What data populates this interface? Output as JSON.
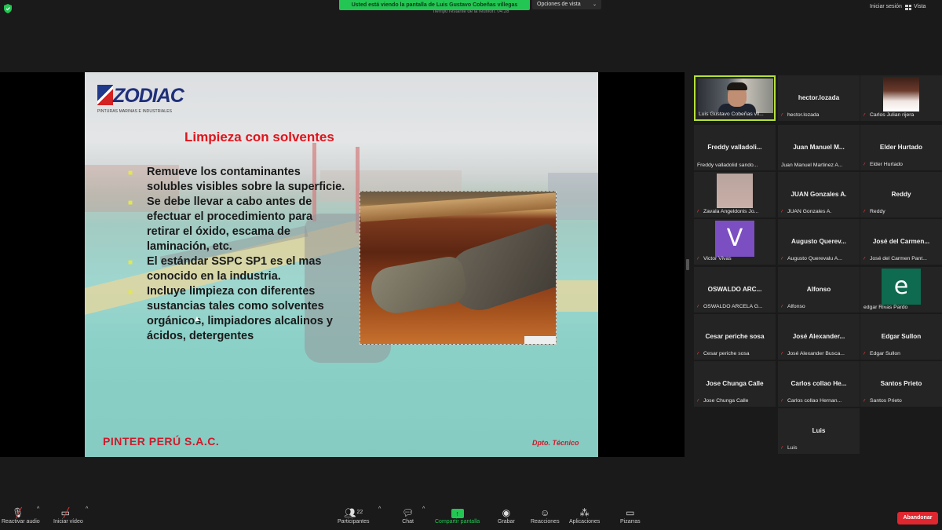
{
  "topbar": {
    "banner": "Usted está viendo la pantalla de Luis Gustavo Cobeñas villegas",
    "banner_sub": "Tiempo restante de la reunión: 04:28",
    "view_options": "Opciones de vista",
    "signin": "Iniciar sesión",
    "vista": "Vista"
  },
  "slide": {
    "logo": "ZODIAC",
    "logo_sub": "PINTURAS MARINAS E INDUSTRIALES",
    "title": "Limpieza con solventes",
    "bullets": [
      "Remueve los contaminantes solubles  visibles sobre la superficie.",
      "Se debe llevar a cabo antes de efectuar el procedimiento para retirar el óxido, escama de laminación, etc.",
      "El estándar SSPC SP1 es el mas conocido en la industria.",
      "Incluye limpieza con diferentes sustancias tales como solventes orgánicos, limpiadores alcalinos y ácidos, detergentes"
    ],
    "company": "PINTER PERÚ S.A.C.",
    "dept": "Dpto. Técnico"
  },
  "participants": [
    {
      "title": "",
      "label": "Luis Gustavo Cobeñas vil...",
      "muted": false,
      "video": true
    },
    {
      "title": "hector.lozada",
      "label": "hector.lozada",
      "muted": true
    },
    {
      "title": "",
      "label": "Carlos Julian rijera",
      "muted": true,
      "thumb": "photo"
    },
    {
      "title": "Freddy  valladoli...",
      "label": "Freddy valladolid sando...",
      "muted": false
    },
    {
      "title": "Juan Manuel M...",
      "label": "Juan Manuel Martinez A...",
      "muted": false
    },
    {
      "title": "Elder Hurtado",
      "label": "Elder Hurtado",
      "muted": true
    },
    {
      "title": "",
      "label": "Zavala Angeldonis Jo...",
      "muted": true,
      "thumb": "blur"
    },
    {
      "title": "JUAN Gonzales A.",
      "label": "JUAN Gonzales A.",
      "muted": true
    },
    {
      "title": "Reddy",
      "label": "Reddy",
      "muted": true
    },
    {
      "title": "",
      "label": "Victor Vivas",
      "muted": true,
      "letter": "V",
      "color": "#7b4fc2"
    },
    {
      "title": "Augusto  Querev...",
      "label": "Augusto Querevalu A...",
      "muted": true
    },
    {
      "title": "José del Carmen...",
      "label": "José del Carmen Pant...",
      "muted": true
    },
    {
      "title": "OSWALDO  ARC...",
      "label": "OSWALDO ARCELA G...",
      "muted": true
    },
    {
      "title": "Alfonso",
      "label": "Alfonso",
      "muted": true
    },
    {
      "title": "",
      "label": "edgar Rivas Pardo",
      "muted": false,
      "letter": "e",
      "color": "#0e6b4f"
    },
    {
      "title": "Cesar periche sosa",
      "label": "Cesar periche sosa",
      "muted": true
    },
    {
      "title": "José  Alexander...",
      "label": "José Alexander Busca...",
      "muted": true
    },
    {
      "title": "Edgar Sullon",
      "label": "Edgar Sullon",
      "muted": true
    },
    {
      "title": "Jose Chunga Calle",
      "label": "Jose Chunga Calle",
      "muted": true
    },
    {
      "title": "Carlos collao He...",
      "label": "Carlos collao Hernan...",
      "muted": true
    },
    {
      "title": "Santos Prieto",
      "label": "Santos Prieto",
      "muted": true
    },
    {
      "title": "Luis",
      "label": "Luis",
      "muted": true
    }
  ],
  "toolbar": {
    "unmute": "Reactivar audio",
    "start_video": "Iniciar vídeo",
    "participants": "Participantes",
    "participants_count": "22",
    "chat": "Chat",
    "share": "Compartir pantalla",
    "record": "Grabar",
    "reactions": "Reacciones",
    "apps": "Aplicaciones",
    "whiteboards": "Pizarras",
    "leave": "Abandonar"
  },
  "colors": {
    "accent_green": "#23c653",
    "leave_red": "#e0262e",
    "active_speaker": "#b5e03c",
    "slide_title": "#e0141b"
  }
}
